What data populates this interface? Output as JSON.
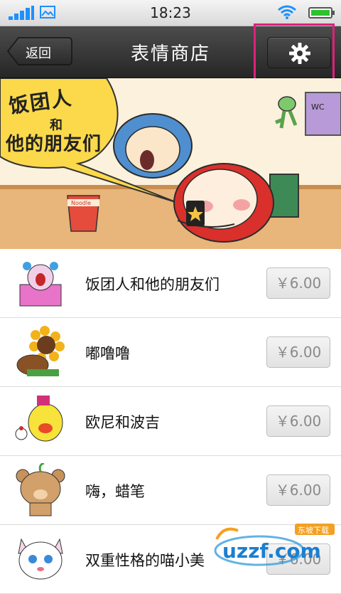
{
  "status": {
    "time": "18:23"
  },
  "header": {
    "back_label": "返回",
    "title": "表情商店"
  },
  "banner": {
    "headline": "饭团人",
    "connector": "和",
    "subline": "他的朋友们"
  },
  "items": [
    {
      "name": "饭团人和他的朋友们",
      "price": "￥6.00"
    },
    {
      "name": "嘟噜噜",
      "price": "￥6.00"
    },
    {
      "name": "欧尼和波吉",
      "price": "￥6.00"
    },
    {
      "name": "嗨，蜡笔",
      "price": "￥6.00"
    },
    {
      "name": "双重性格的喵小美",
      "price": "￥6.00"
    }
  ],
  "watermark": {
    "text": "uzzf.com",
    "sub": "东坡下载"
  },
  "colors": {
    "highlight": "#e0207a",
    "titlebar": "#333333",
    "signal": "#1e90ff",
    "battery": "#2fc22f"
  },
  "icons": [
    "signal-icon",
    "image-icon",
    "wifi-icon",
    "battery-icon",
    "back-arrow-icon",
    "gear-icon"
  ]
}
